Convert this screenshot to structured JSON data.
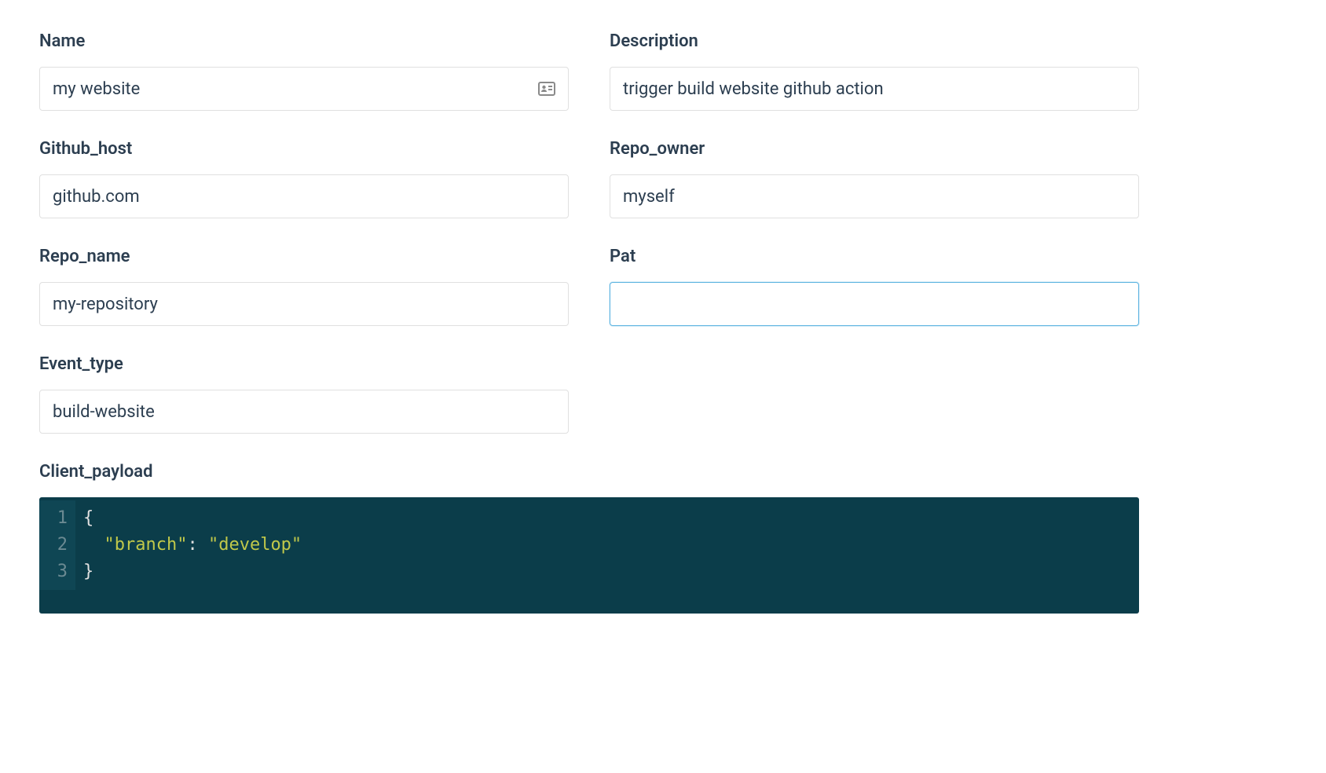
{
  "fields": {
    "name": {
      "label": "Name",
      "value": "my website"
    },
    "description": {
      "label": "Description",
      "value": "trigger build website github action"
    },
    "github_host": {
      "label": "Github_host",
      "value": "github.com"
    },
    "repo_owner": {
      "label": "Repo_owner",
      "value": "myself"
    },
    "repo_name": {
      "label": "Repo_name",
      "value": "my-repository"
    },
    "pat": {
      "label": "Pat",
      "value": ""
    },
    "event_type": {
      "label": "Event_type",
      "value": "build-website"
    },
    "client_payload": {
      "label": "Client_payload"
    }
  },
  "code": {
    "lines": [
      "1",
      "2",
      "3"
    ],
    "line1_open": "{",
    "line2_key": "\"branch\"",
    "line2_colon": ": ",
    "line2_val": "\"develop\"",
    "line3_close": "}"
  }
}
